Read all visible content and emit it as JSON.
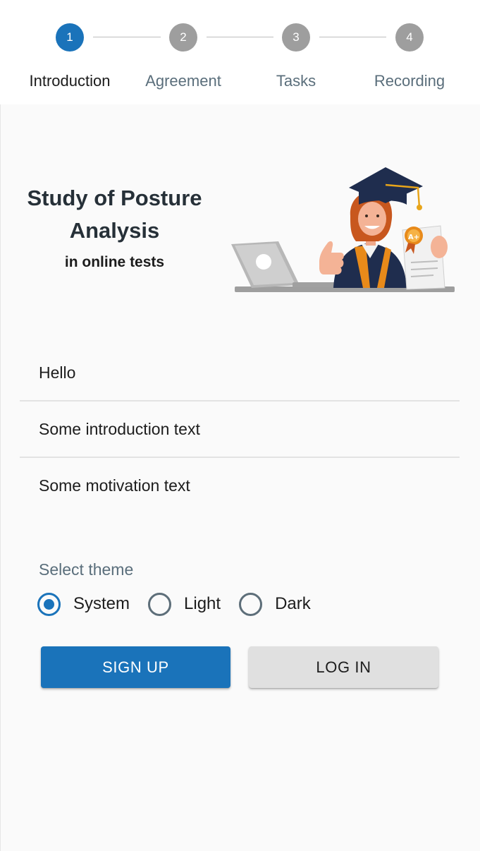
{
  "stepper": {
    "steps": [
      {
        "number": "1",
        "label": "Introduction",
        "state": "active"
      },
      {
        "number": "2",
        "label": "Agreement",
        "state": "inactive"
      },
      {
        "number": "3",
        "label": "Tasks",
        "state": "inactive"
      },
      {
        "number": "4",
        "label": "Recording",
        "state": "inactive"
      }
    ]
  },
  "hero": {
    "title": "Study of Posture Analysis",
    "subtitle": "in online tests",
    "illustration_icon": "graduate-with-laptop-and-certificate-illustration",
    "certificate_badge_text": "A+"
  },
  "list": {
    "items": [
      {
        "text": "Hello"
      },
      {
        "text": "Some introduction text"
      },
      {
        "text": "Some motivation text"
      }
    ]
  },
  "theme": {
    "legend": "Select theme",
    "selected": "System",
    "options": [
      "System",
      "Light",
      "Dark"
    ]
  },
  "actions": {
    "sign_up_label": "SIGN UP",
    "log_in_label": "LOG IN"
  },
  "colors": {
    "primary": "#1a73ba",
    "inactive_step": "#9e9e9e",
    "muted_text": "#5a6e7b",
    "background": "#fafafa"
  }
}
